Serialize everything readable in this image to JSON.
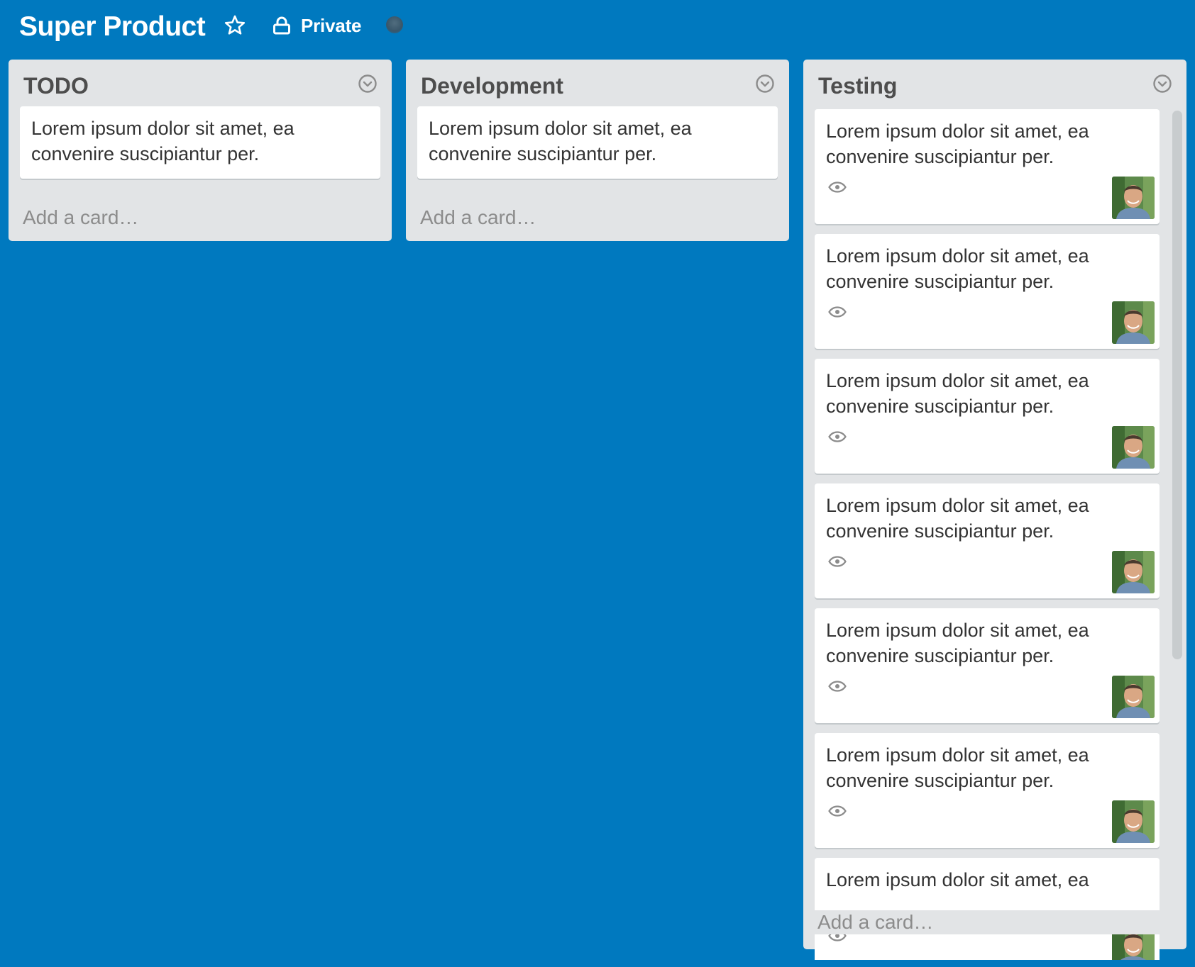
{
  "board": {
    "title": "Super Product",
    "visibility": "Private",
    "background_color": "#0079bf"
  },
  "icons": {
    "star": "star-icon",
    "lock": "lock-icon",
    "list_menu": "chevron-down-circle-icon",
    "watch": "eye-icon",
    "avatar": "member-avatar"
  },
  "lists": [
    {
      "title": "TODO",
      "cards": [
        "Lorem ipsum dolor sit amet, ea convenire suscipiantur per."
      ],
      "add_card": "Add a card…"
    },
    {
      "title": "Development",
      "cards": [
        "Lorem ipsum dolor sit amet, ea convenire suscipiantur per."
      ],
      "add_card": "Add a card…"
    },
    {
      "title": "Testing",
      "cards": [
        "Lorem ipsum dolor sit amet, ea convenire suscipiantur per.",
        "Lorem ipsum dolor sit amet, ea convenire suscipiantur per.",
        "Lorem ipsum dolor sit amet, ea convenire suscipiantur per.",
        "Lorem ipsum dolor sit amet, ea convenire suscipiantur per.",
        "Lorem ipsum dolor sit amet, ea convenire suscipiantur per.",
        "Lorem ipsum dolor sit amet, ea convenire suscipiantur per.",
        "Lorem ipsum dolor sit amet, ea"
      ],
      "add_card": "Add a card…"
    }
  ]
}
